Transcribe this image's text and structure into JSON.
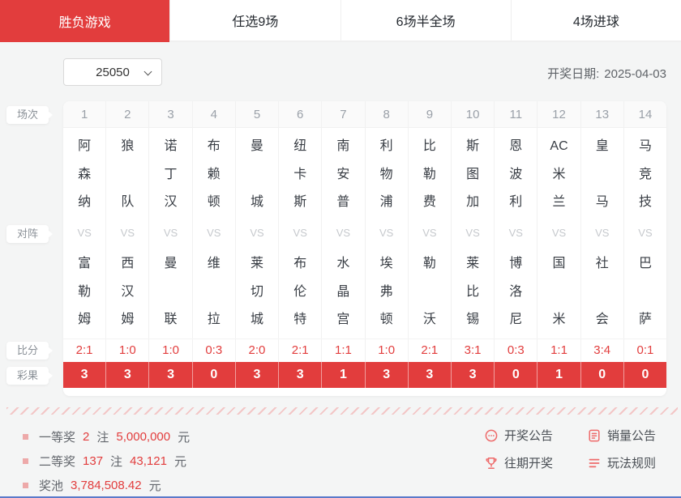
{
  "tabs": [
    {
      "label": "胜负游戏",
      "active": true
    },
    {
      "label": "任选9场",
      "active": false
    },
    {
      "label": "6场半全场",
      "active": false
    },
    {
      "label": "4场进球",
      "active": false
    }
  ],
  "controls": {
    "issue_select_value": "25050",
    "draw_date_label": "开奖日期:",
    "draw_date_value": "2025-04-03"
  },
  "table": {
    "row_labels": {
      "round": "场次",
      "matchup": "对阵",
      "score": "比分",
      "result": "彩果"
    },
    "vs_label": "VS",
    "matches": [
      {
        "no": "1",
        "home": [
          "阿",
          "森",
          "纳"
        ],
        "away": [
          "富",
          "勒",
          "姆"
        ],
        "score": "2:1",
        "result": "3"
      },
      {
        "no": "2",
        "home": [
          "狼",
          "队"
        ],
        "away": [
          "西",
          "汉",
          "姆"
        ],
        "score": "1:0",
        "result": "3"
      },
      {
        "no": "3",
        "home": [
          "诺",
          "丁",
          "汉"
        ],
        "away": [
          "曼",
          "联"
        ],
        "score": "1:0",
        "result": "3"
      },
      {
        "no": "4",
        "home": [
          "布",
          "赖",
          "顿"
        ],
        "away": [
          "维",
          "拉"
        ],
        "score": "0:3",
        "result": "0"
      },
      {
        "no": "5",
        "home": [
          "曼",
          "城"
        ],
        "away": [
          "莱",
          "切",
          "城"
        ],
        "score": "2:0",
        "result": "3"
      },
      {
        "no": "6",
        "home": [
          "纽",
          "卡",
          "斯"
        ],
        "away": [
          "布",
          "伦",
          "特"
        ],
        "score": "2:1",
        "result": "3"
      },
      {
        "no": "7",
        "home": [
          "南",
          "安",
          "普"
        ],
        "away": [
          "水",
          "晶",
          "宫"
        ],
        "score": "1:1",
        "result": "1"
      },
      {
        "no": "8",
        "home": [
          "利",
          "物",
          "浦"
        ],
        "away": [
          "埃",
          "弗",
          "顿"
        ],
        "score": "1:0",
        "result": "3"
      },
      {
        "no": "9",
        "home": [
          "比",
          "勒",
          "费"
        ],
        "away": [
          "勒",
          "沃"
        ],
        "score": "2:1",
        "result": "3"
      },
      {
        "no": "10",
        "home": [
          "斯",
          "图",
          "加"
        ],
        "away": [
          "莱",
          "比",
          "锡"
        ],
        "score": "3:1",
        "result": "3"
      },
      {
        "no": "11",
        "home": [
          "恩",
          "波",
          "利"
        ],
        "away": [
          "博",
          "洛",
          "尼"
        ],
        "score": "0:3",
        "result": "0"
      },
      {
        "no": "12",
        "home": [
          "AC",
          "米",
          "兰"
        ],
        "away": [
          "国",
          "米"
        ],
        "score": "1:1",
        "result": "1"
      },
      {
        "no": "13",
        "home": [
          "皇",
          "马"
        ],
        "away": [
          "社",
          "会"
        ],
        "score": "3:4",
        "result": "0"
      },
      {
        "no": "14",
        "home": [
          "马",
          "竞",
          "技"
        ],
        "away": [
          "巴",
          "萨"
        ],
        "score": "0:1",
        "result": "0"
      }
    ]
  },
  "summary": {
    "prizes": [
      {
        "label": "一等奖",
        "count": "2",
        "count_unit": "注",
        "amount": "5,000,000",
        "amount_unit": "元"
      },
      {
        "label": "二等奖",
        "count": "137",
        "count_unit": "注",
        "amount": "43,121",
        "amount_unit": "元"
      },
      {
        "label": "奖池",
        "amount": "3,784,508.42",
        "amount_unit": "元"
      }
    ],
    "links": [
      {
        "label": "开奖公告",
        "icon": "speech-ellipsis-icon",
        "name": "draw-announcement-link"
      },
      {
        "label": "销量公告",
        "icon": "document-icon",
        "name": "sales-announcement-link"
      },
      {
        "label": "往期开奖",
        "icon": "trophy-icon",
        "name": "past-draws-link"
      },
      {
        "label": "玩法规则",
        "icon": "list-icon",
        "name": "rules-link"
      }
    ]
  },
  "colors": {
    "accent_red": "#e23d3d",
    "icon_red": "#ee6a6a",
    "hatch_pink": "#f3c6c6",
    "footer_blue": "#5b7ac9"
  }
}
